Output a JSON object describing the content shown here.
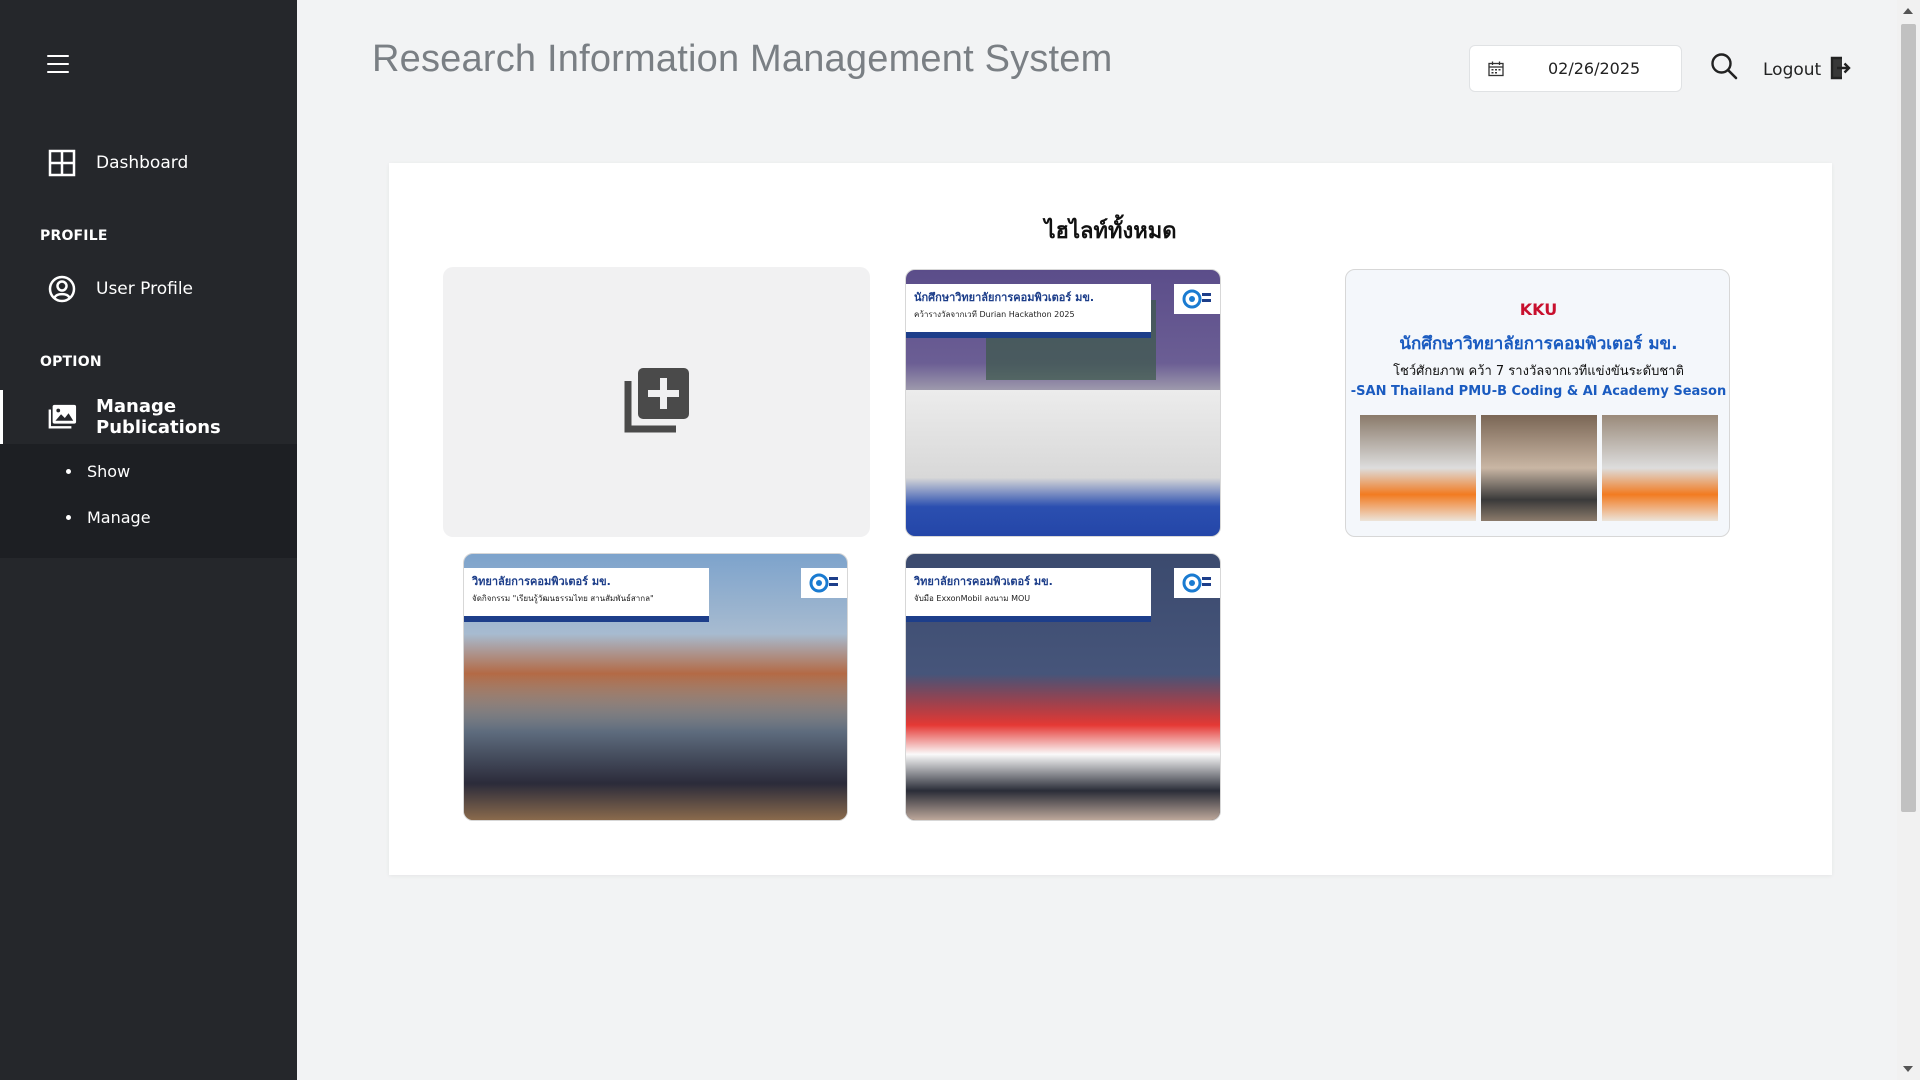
{
  "app": {
    "title": "Research Information Management System"
  },
  "sidebar": {
    "dashboard": {
      "label": "Dashboard",
      "icon": "grid-icon"
    },
    "profile_section": "PROFILE",
    "user_profile": {
      "label": "User Profile",
      "icon": "user-circle-icon"
    },
    "option_section": "OPTION",
    "manage_publications": {
      "label": "Manage Publications",
      "icon": "photos-icon"
    },
    "sub_items": [
      {
        "label": "Show"
      },
      {
        "label": "Manage"
      }
    ]
  },
  "header": {
    "date": "02/26/2025",
    "logout_label": "Logout"
  },
  "content": {
    "title": "ไฮไลท์ทั้งหมด",
    "add_icon": "add-photo-library-icon",
    "highlights": [
      {
        "headline": "นักศึกษาวิทยาลัยการคอมพิวเตอร์ มข.",
        "subline": "คว้ารางวัลจากเวที Durian Hackathon 2025"
      },
      {
        "headline": "นักศึกษาวิทยาลัยการคอมพิวเตอร์ มข.",
        "subline": "โชว์ศักยภาพ คว้า 7 รางวัลจากเวทีแข่งขันระดับชาติ",
        "caption": "-SAN Thailand PMU-B Coding & AI Academy Season",
        "brand": "KKU"
      },
      {
        "headline": "วิทยาลัยการคอมพิวเตอร์ มข.",
        "subline": "จัดกิจกรรม \"เรียนรู้วัฒนธรรมไทย สานสัมพันธ์สากล\""
      },
      {
        "headline": "วิทยาลัยการคอมพิวเตอร์ มข.",
        "subline": "จับมือ ExxonMobil ลงนาม MOU"
      }
    ]
  },
  "colors": {
    "sidebar_bg": "#25272b",
    "accent_blue": "#1d3e8a"
  }
}
